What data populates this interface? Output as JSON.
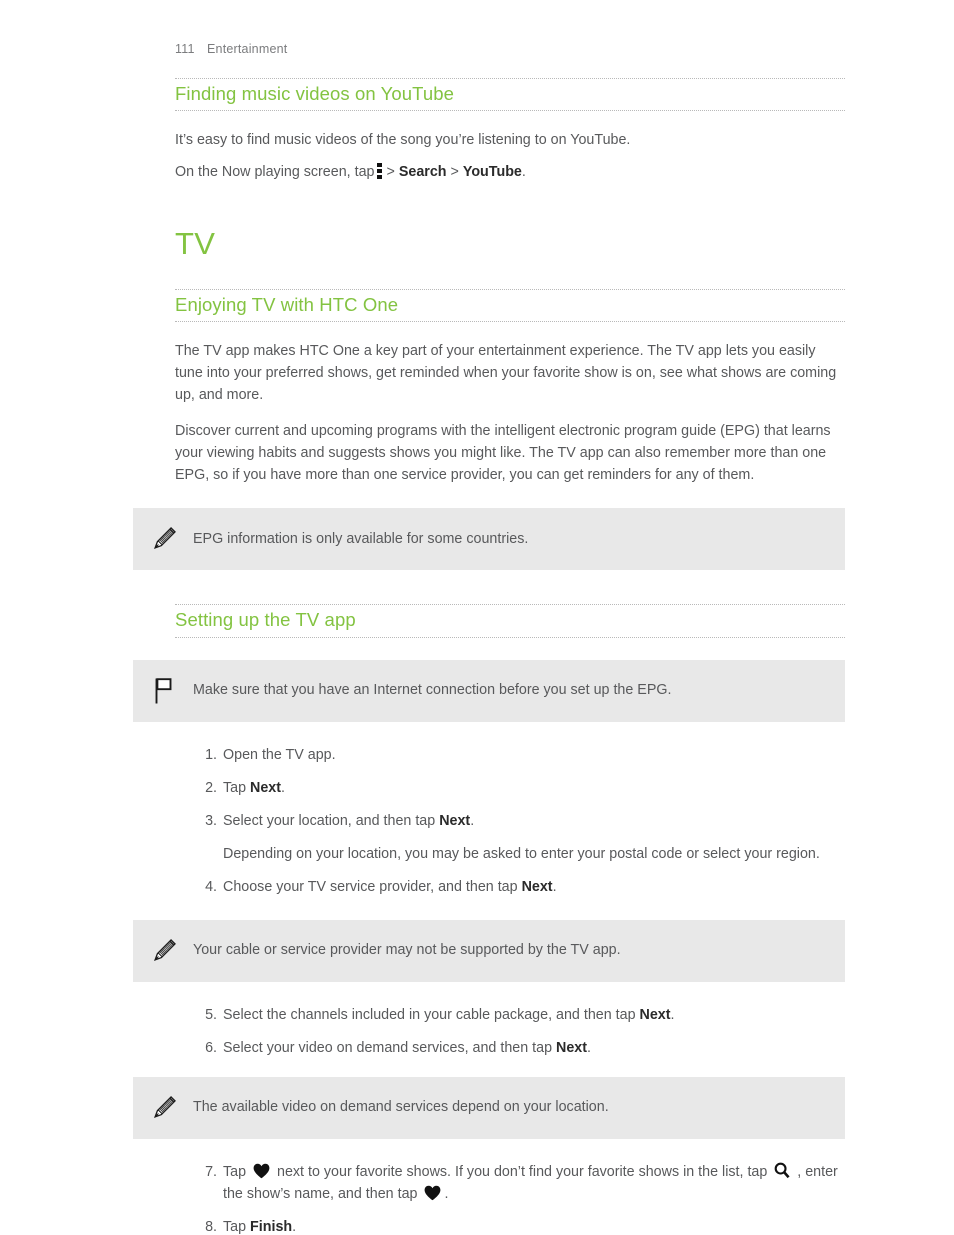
{
  "header": {
    "page_number": "111",
    "section": "Entertainment"
  },
  "colors": {
    "heading_green": "#83c341",
    "body_text": "#58595b",
    "note_bg": "#e8e8e8",
    "rule": "#b9b9b9"
  },
  "sections": {
    "youtube": {
      "heading": "Finding music videos on YouTube",
      "intro": "It’s easy to find music videos of the song you’re listening to on YouTube.",
      "instruction_pre": "On the Now playing screen, tap",
      "instruction_sep1": ">",
      "instruction_search": "Search",
      "instruction_sep2": ">",
      "instruction_youtube": "YouTube",
      "instruction_end": ".",
      "icon": "overflow-menu-icon"
    },
    "tv": {
      "title": "TV",
      "enjoying": {
        "heading": "Enjoying TV with HTC One",
        "paragraph1": "The TV app makes HTC One a key part of your entertainment experience. The TV app lets you easily tune into your preferred shows, get reminded when your favorite show is on, see what shows are coming up, and more.",
        "paragraph2": "Discover current and upcoming programs with the intelligent electronic program guide (EPG) that learns your viewing habits and suggests shows you might like. The TV app can also remember more than one EPG, so if you have more than one service provider, you can get reminders for any of them.",
        "note1": {
          "icon": "pencil-icon",
          "text": "EPG information is only available for some countries."
        }
      },
      "setup": {
        "heading": "Setting up the TV app",
        "tip": {
          "icon": "flag-icon",
          "text": "Make sure that you have an Internet connection before you set up the EPG."
        },
        "steps_part1": [
          {
            "num": "1.",
            "text": "Open the TV app."
          },
          {
            "num": "2.",
            "text_pre": "Tap ",
            "bold": "Next",
            "text_post": "."
          },
          {
            "num": "3.",
            "text_pre": "Select your location, and then tap ",
            "bold": "Next",
            "text_post": ".",
            "sub": "Depending on your location, you may be asked to enter your postal code or select your region."
          },
          {
            "num": "4.",
            "text_pre": "Choose your TV service provider, and then tap ",
            "bold": "Next",
            "text_post": "."
          }
        ],
        "note2": {
          "icon": "pencil-icon",
          "text": "Your cable or service provider may not be supported by the TV app."
        },
        "steps_part2": [
          {
            "num": "5.",
            "text_pre": "Select the channels included in your cable package, and then tap ",
            "bold": "Next",
            "text_post": "."
          },
          {
            "num": "6.",
            "text_pre": "Select your video on demand services, and then tap ",
            "bold": "Next",
            "text_post": "."
          }
        ],
        "note3": {
          "icon": "pencil-icon",
          "text": "The available video on demand services depend on your location."
        },
        "steps_part3": {
          "step7": {
            "num": "7.",
            "seg1": "Tap ",
            "icon1": "heart-icon",
            "seg2": " next to your favorite shows. If you don’t find your favorite shows in the list, tap ",
            "icon2": "search-icon",
            "seg3": " , enter the show’s name, and then tap ",
            "icon3": "heart-icon",
            "seg4": "."
          },
          "step8": {
            "num": "8.",
            "text_pre": "Tap ",
            "bold": "Finish",
            "text_post": "."
          }
        }
      }
    }
  }
}
